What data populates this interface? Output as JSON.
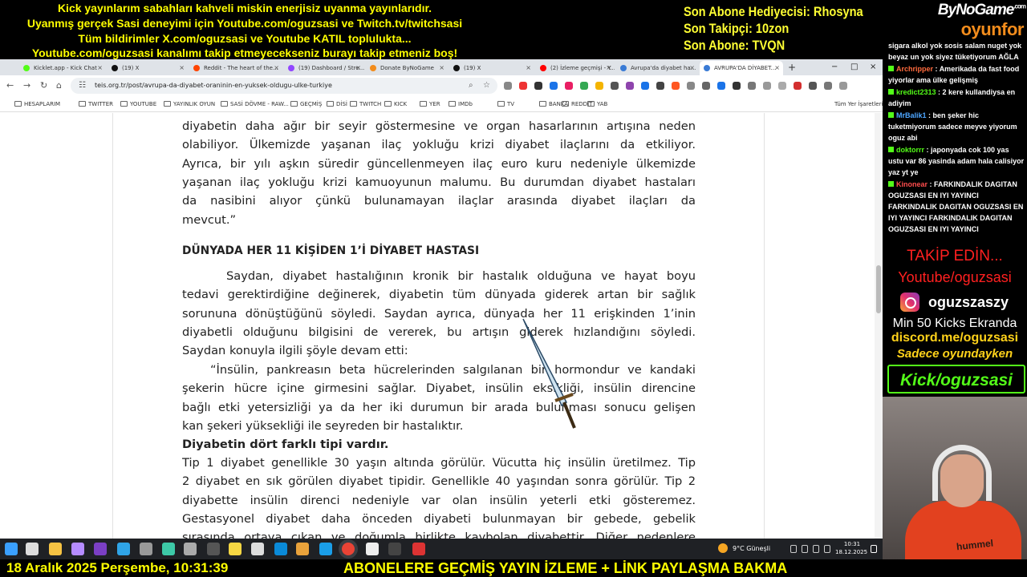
{
  "overlay": {
    "line1": "Kick yayınlarım sabahları kahveli miskin enerjisiz uyanma yayınlarıdır.",
    "line2": "Uyanmış gerçek Sasi deneyimi için Youtube.com/oguzsasi ve Twitch.tv/twitchsasi",
    "line3": "Tüm bildirimler X.com/oguzsasi ve Youtube KATIL toplulukta...",
    "line4": "Youtube.com/oguzsasi kanalımı takip etmeyecekseniz burayı takip etmeniz boş!",
    "stat_gift": "Son Abone Hediyecisi: Rhosyna",
    "stat_follower": "Son Takipçi: 10zon",
    "stat_sub": "Son Abone: TVQN",
    "accent_color": "#ffff00"
  },
  "brand": {
    "top": "ByNoGame",
    "bottom": "oyunfor",
    "superscript": ".com"
  },
  "browser": {
    "tabs": [
      {
        "label": "Kicklet.app - Kick Chat",
        "favicon": "kick-icon",
        "color": "#53fc18"
      },
      {
        "label": "(19) X",
        "favicon": "x-icon",
        "color": "#111"
      },
      {
        "label": "Reddit - The heart of the...",
        "favicon": "reddit-icon",
        "color": "#ff4500"
      },
      {
        "label": "(19) Dashboard / Stre...",
        "favicon": "twitch-icon",
        "color": "#9146ff"
      },
      {
        "label": "Donate ByNoGame",
        "favicon": "bynogame-icon",
        "color": "#f28c1c"
      },
      {
        "label": "(19) X",
        "favicon": "x-icon",
        "color": "#111"
      },
      {
        "label": "(2) İzleme geçmişi - Y...",
        "favicon": "youtube-icon",
        "color": "#ff0000"
      },
      {
        "label": "Avrupa'da diyabet ha...",
        "favicon": "globe-icon",
        "color": "#3a7bd5"
      },
      {
        "label": "AVRUPA'DA DİYABET...",
        "favicon": "globe-icon",
        "color": "#3a7bd5"
      }
    ],
    "url": "teis.org.tr/post/avrupa-da-diyabet-oraninin-en-yuksek-oldugu-ulke-turkiye",
    "bookmarks": [
      "HESAPLARIM",
      "TWITTER",
      "YOUTUBE",
      "YAYINLIK OYUN",
      "SASİ DÖVME - RAW...",
      "GEÇMİŞ",
      "DİSİ",
      "TWITCH",
      "KICK",
      "YER",
      "IMDb",
      "TV",
      "BANKA",
      "REDDIT",
      "YAB"
    ],
    "all_bookmarks": "Tüm Yer İşaretleri"
  },
  "article": {
    "lines": [
      "diyabetin daha ağır bir seyir göstermesine ve organ hasarlarının artışına neden",
      "olabiliyor. Ülkemizde yaşanan ilaç yokluğu krizi diyabet ilaçlarını da etkiliyor.",
      "Ayrıca, bir yılı aşkın süredir güncellenmeyen ilaç euro kuru nedeniyle ülkemizde",
      "yaşanan ilaç yokluğu krizi kamuoyunun malumu. Bu durumdan diyabet hastaları",
      "da nasibini alıyor çünkü bulunamayan ilaçlar arasında diyabet ilaçları da",
      "mevcut.”"
    ],
    "heading": "DÜNYADA HER 11 KİŞİDEN 1’İ DİYABET HASTASI",
    "para2": [
      "Saydan, diyabet hastalığının kronik bir hastalık olduğuna ve hayat boyu",
      "tedavi gerektirdiğine değinerek, diyabetin tüm dünyada giderek artan bir sağlık",
      "sorununa dönüştüğünü söyledi. Saydan ayrıca, dünyada her 11 erişkinden 1’inin",
      "diyabetli olduğunu bilgisini de vererek, bu artışın giderek hızlandığını söyledi.",
      "Saydan konuyla ilgili şöyle devam etti:"
    ],
    "para3": [
      "“İnsülin, pankreasın beta hücrelerinden salgılanan bir hormondur ve kandaki",
      "şekerin hücre içine girmesini sağlar. Diyabet, insülin eksikliği, insülin direncine",
      "bağlı etki yetersizliği ya da her iki durumun bir arada bulunması sonucu gelişen",
      "kan şekeri yüksekliği ile seyreden bir hastalıktır."
    ],
    "bold_line": "Diyabetin dört farklı tipi vardır.",
    "para4": [
      " Tip 1 diyabet genellikle 30 yaşın altında görülür. Vücutta hiç insülin üretilmez. Tip",
      "2 diyabet en sık görülen diyabet tipidir. Genellikle 40 yaşından sonra görülür. Tip 2",
      "diyabette insülin direnci nedeniyle var olan insülin yeterli etki gösteremez.",
      "Gestasyonel diyabet daha önceden diyabeti bulunmayan bir gebede, gebelik",
      "sırasında ortaya çıkan ve doğumla birlikte kaybolan diyabettir. Diğer nedenlere"
    ]
  },
  "chat": {
    "messages": [
      {
        "user": "",
        "text": "sigara alkol yok sosis salam nuget yok beyaz un yok siyez tüketiyorum AĞLA",
        "user_color": "#ffffff"
      },
      {
        "user": "Archripper",
        "text": "Amerikada da fast food yiyorlar ama ülke gelişmiş",
        "user_color": "#ff6b3d"
      },
      {
        "user": "kredict2313",
        "text": "2 kere kullandiysa en adiyim",
        "user_color": "#53fc18"
      },
      {
        "user": "MrBalik1",
        "text": "ben şeker hic tuketmiyorum sadece meyve yiyorum oguz abi",
        "user_color": "#4da6ff"
      },
      {
        "user": "doktorrr",
        "text": "japonyada cok 100 yas ustu var 86 yasinda adam hala calisiyor yaz yt ye",
        "user_color": "#53fc18"
      },
      {
        "user": "Kinonear",
        "text": "FARKINDALIK DAGITAN OGUZSASI EN IYI YAYINCI FARKINDALIK DAGITAN OGUZSASI EN IYI YAYINCI FARKINDALIK DAGITAN OGUZSASI EN IYI YAYINCI",
        "user_color": "#ff4d4d"
      }
    ]
  },
  "promo": {
    "takip": "TAKİP EDİN...",
    "youtube": "Youtube/oguzsasi",
    "instagram": "oguzszaszy",
    "kicks": "Min 50 Kicks Ekranda",
    "discord": "discord.me/oguzsasi",
    "sadece": "Sadece oyundayken",
    "kick": "Kick/oguzsasi"
  },
  "webcam": {
    "shirt_logo": "hummel"
  },
  "taskbar": {
    "weather": "9°C  Güneşli",
    "time": "10:31",
    "date": "18.12.2025"
  },
  "bottom": {
    "datetime": "18 Aralık 2025 Perşembe, 10:31:39",
    "ticker": "ABONELERE GEÇMİŞ YAYIN İZLEME + LİNK PAYLAŞMA BAKMA"
  }
}
